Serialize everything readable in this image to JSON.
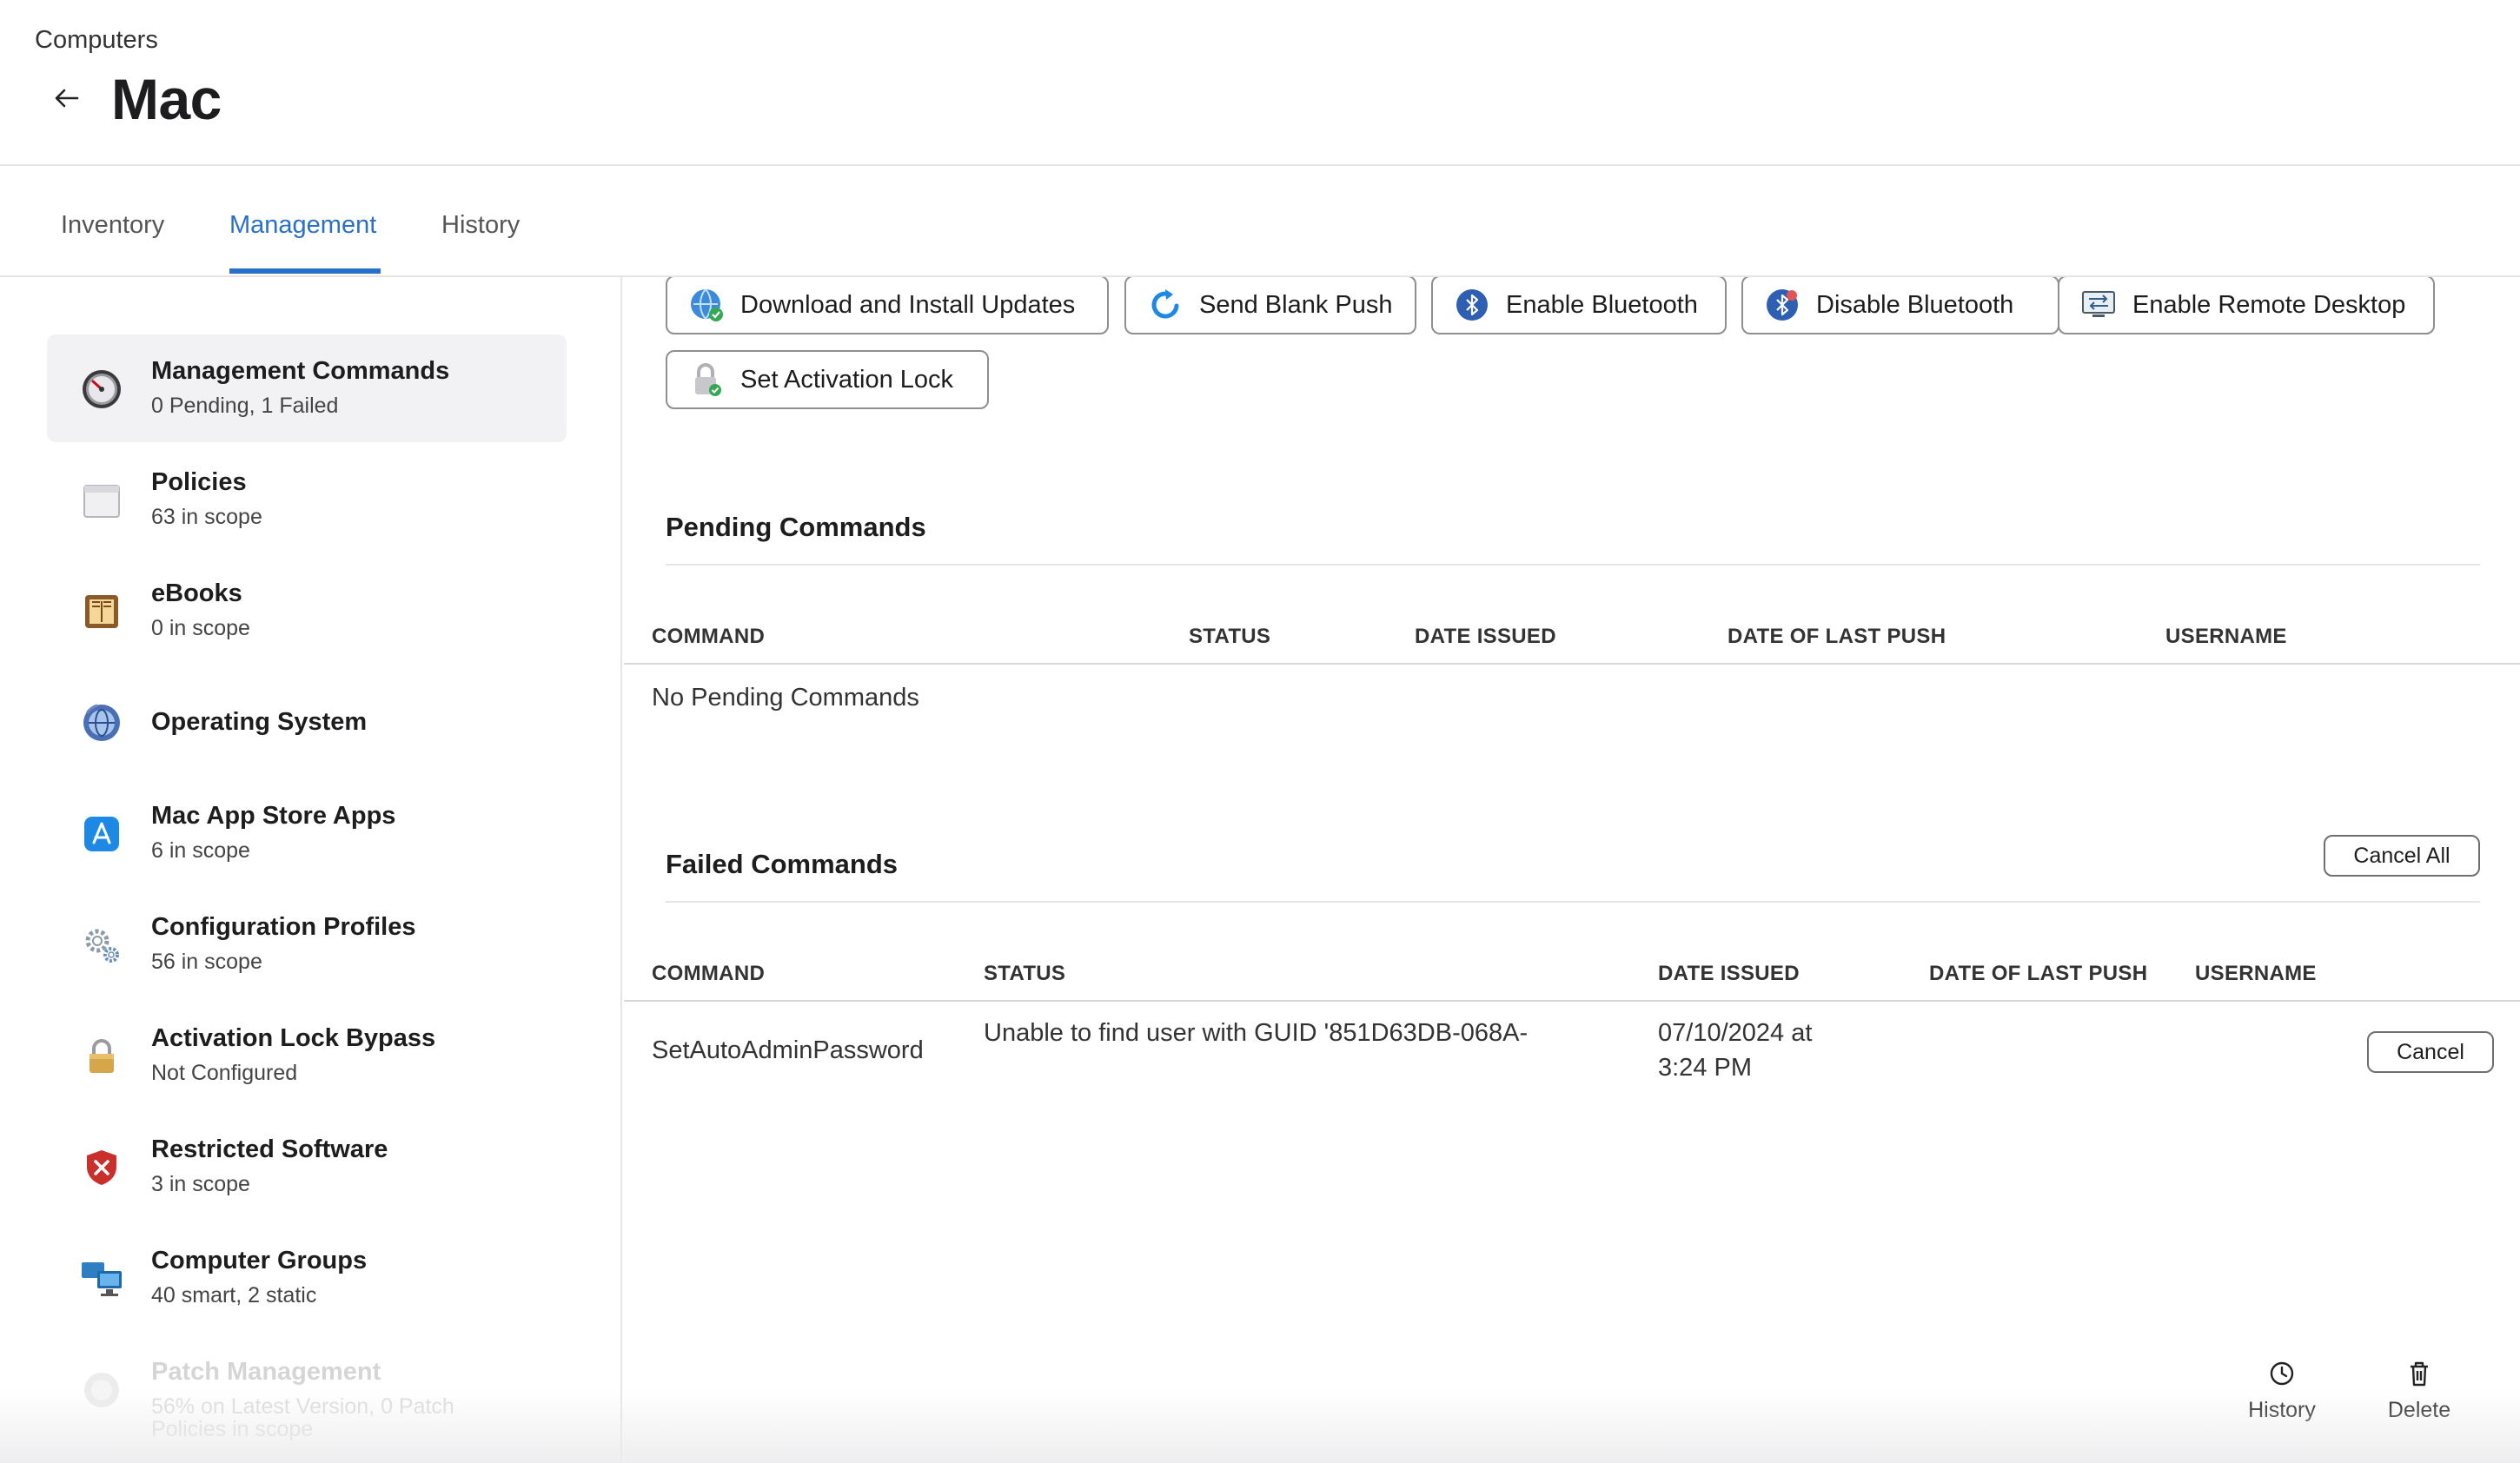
{
  "header": {
    "breadcrumb": "Computers",
    "title": "Mac"
  },
  "tabs": [
    {
      "label": "Inventory"
    },
    {
      "label": "Management"
    },
    {
      "label": "History"
    }
  ],
  "sidebar": {
    "items": [
      {
        "title": "Management Commands",
        "subtitle": "0 Pending, 1 Failed",
        "icon": "gauge-icon"
      },
      {
        "title": "Policies",
        "subtitle": "63 in scope",
        "icon": "window-icon"
      },
      {
        "title": "eBooks",
        "subtitle": "0 in scope",
        "icon": "book-icon"
      },
      {
        "title": "Operating System",
        "subtitle": "",
        "icon": "globe-icon"
      },
      {
        "title": "Mac App Store Apps",
        "subtitle": "6 in scope",
        "icon": "app-store-icon"
      },
      {
        "title": "Configuration Profiles",
        "subtitle": "56 in scope",
        "icon": "gears-icon"
      },
      {
        "title": "Activation Lock Bypass",
        "subtitle": "Not Configured",
        "icon": "padlock-icon"
      },
      {
        "title": "Restricted Software",
        "subtitle": "3 in scope",
        "icon": "shield-icon"
      },
      {
        "title": "Computer Groups",
        "subtitle": "40 smart, 2 static",
        "icon": "computers-icon"
      },
      {
        "title": "Patch Management",
        "subtitle": "56% on Latest Version, 0 Patch",
        "subtitle2": "Policies in scope",
        "icon": "patch-icon"
      }
    ]
  },
  "commands": {
    "buttons": [
      {
        "label": "Download and Install Updates",
        "icon": "globe-update-icon"
      },
      {
        "label": "Send Blank Push",
        "icon": "refresh-icon"
      },
      {
        "label": "Enable Bluetooth",
        "icon": "bluetooth-icon"
      },
      {
        "label": "Disable Bluetooth",
        "icon": "bluetooth-off-icon"
      },
      {
        "label": "Enable Remote Desktop",
        "icon": "remote-desktop-icon"
      },
      {
        "label": "Set Activation Lock",
        "icon": "lock-check-icon"
      }
    ]
  },
  "pending": {
    "title": "Pending Commands",
    "columns": [
      "COMMAND",
      "STATUS",
      "DATE ISSUED",
      "DATE OF LAST PUSH",
      "USERNAME"
    ],
    "empty_text": "No Pending Commands"
  },
  "failed": {
    "title": "Failed Commands",
    "cancel_all_label": "Cancel All",
    "columns": [
      "COMMAND",
      "STATUS",
      "DATE ISSUED",
      "DATE OF LAST PUSH",
      "USERNAME"
    ],
    "rows": [
      {
        "command": "SetAutoAdminPassword",
        "status": "Unable to find user with GUID '851D63DB-068A-",
        "date_issued_line1": "07/10/2024 at",
        "date_issued_line2": "3:24 PM",
        "date_last_push": "",
        "username": "",
        "cancel_label": "Cancel"
      }
    ]
  },
  "footer": {
    "history_label": "History",
    "delete_label": "Delete"
  },
  "colors": {
    "accent": "#2a6fc9",
    "border": "#e5e5e5"
  }
}
